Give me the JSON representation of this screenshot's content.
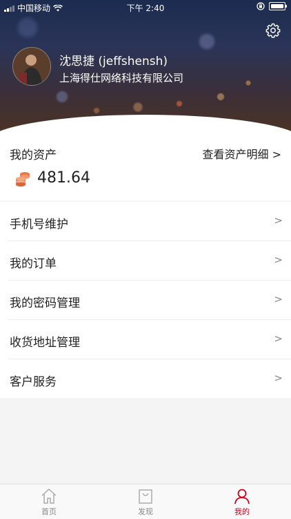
{
  "status_bar": {
    "carrier": "中国移动",
    "time": "下午 2:40"
  },
  "profile": {
    "name": "沈思捷 (jeffshensh)",
    "company": "上海得仕网络科技有限公司"
  },
  "assets": {
    "title": "我的资产",
    "detail_link": "查看资产明细 >",
    "amount": "481.64"
  },
  "menu": [
    {
      "label": "手机号维护",
      "arrow": ">"
    },
    {
      "label": "我的订单",
      "arrow": ">"
    },
    {
      "label": "我的密码管理",
      "arrow": ">"
    },
    {
      "label": "收货地址管理",
      "arrow": ">"
    },
    {
      "label": "客户服务",
      "arrow": ">"
    }
  ],
  "tabs": [
    {
      "label": "首页",
      "icon": "home-icon",
      "active": false
    },
    {
      "label": "发现",
      "icon": "bag-icon",
      "active": false
    },
    {
      "label": "我的",
      "icon": "user-icon",
      "active": true
    }
  ],
  "colors": {
    "accent": "#d0021b",
    "coin": "#e8794a"
  }
}
